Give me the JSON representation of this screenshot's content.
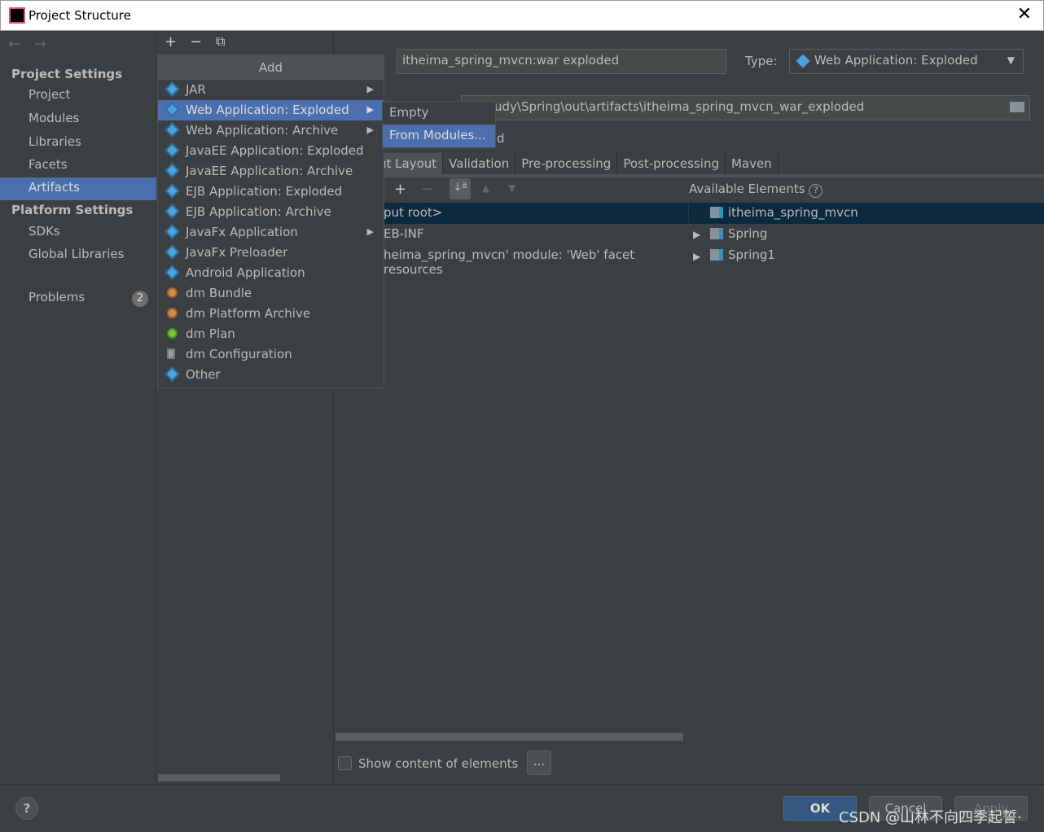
{
  "window": {
    "title": "Project Structure",
    "close": "✕"
  },
  "toolbar": {
    "back": "←",
    "forward": "→",
    "add": "+",
    "remove": "−",
    "copy": "⧉"
  },
  "sidebar": {
    "project_settings": "Project Settings",
    "project_items": [
      "Project",
      "Modules",
      "Libraries",
      "Facets",
      "Artifacts"
    ],
    "selected": "Artifacts",
    "platform_settings": "Platform Settings",
    "platform_items": [
      "SDKs",
      "Global Libraries"
    ],
    "problems": "Problems",
    "problems_count": "2"
  },
  "add_menu": {
    "title": "Add",
    "items": [
      {
        "label": "JAR",
        "icon": "artifact-icon",
        "submenu": true
      },
      {
        "label": "Web Application: Exploded",
        "icon": "web-artifact-icon",
        "submenu": true,
        "selected": true
      },
      {
        "label": "Web Application: Archive",
        "icon": "web-artifact-icon",
        "submenu": true
      },
      {
        "label": "JavaEE Application: Exploded",
        "icon": "javaee-icon"
      },
      {
        "label": "JavaEE Application: Archive",
        "icon": "javaee-icon"
      },
      {
        "label": "EJB Application: Exploded",
        "icon": "ejb-icon"
      },
      {
        "label": "EJB Application: Archive",
        "icon": "ejb-icon"
      },
      {
        "label": "JavaFx Application",
        "icon": "javafx-icon",
        "submenu": true
      },
      {
        "label": "JavaFx Preloader",
        "icon": "javafx-icon"
      },
      {
        "label": "Android Application",
        "icon": "android-icon"
      },
      {
        "label": "dm Bundle",
        "icon": "dm-bundle-icon"
      },
      {
        "label": "dm Platform Archive",
        "icon": "dm-bundle-icon"
      },
      {
        "label": "dm Plan",
        "icon": "dm-plan-icon"
      },
      {
        "label": "dm Configuration",
        "icon": "dm-config-icon"
      },
      {
        "label": "Other",
        "icon": "artifact-icon"
      }
    ]
  },
  "submenu": {
    "items": [
      "Empty",
      "From Modules..."
    ],
    "selected": "From Modules..."
  },
  "artifact": {
    "name": "itheima_spring_mvcn:war exploded",
    "type_label": "Type:",
    "type_value": "Web Application: Exploded",
    "output_dir": "udy\\Spring\\out\\artifacts\\itheima_spring_mvcn_war_exploded",
    "partial": "d"
  },
  "tabs": [
    "ut Layout",
    "Validation",
    "Pre-processing",
    "Post-processing",
    "Maven"
  ],
  "layout": {
    "available_label": "Available Elements",
    "help": "?",
    "left_rows": [
      "put root>",
      "EB-INF",
      "heima_spring_mvcn' module: 'Web' facet resources"
    ],
    "available": [
      "itheima_spring_mvcn",
      "Spring",
      "Spring1"
    ]
  },
  "show_content": {
    "label": "Show content of elements",
    "checked": false,
    "more": "..."
  },
  "footer": {
    "help": "?",
    "ok": "OK",
    "cancel": "Cancel",
    "apply": "Apply",
    "watermark": "CSDN @山林不向四季起誓·"
  },
  "colors": {
    "accent": "#4b6eaf",
    "background": "#3c3f41",
    "tree_selection": "#0d293e"
  }
}
